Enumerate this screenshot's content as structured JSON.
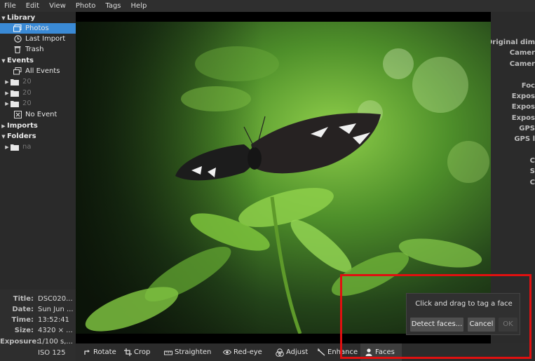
{
  "menu": [
    "File",
    "Edit",
    "View",
    "Photo",
    "Tags",
    "Help"
  ],
  "sidebar": {
    "library_header": "Library",
    "library_items": [
      "Photos",
      "Last Import",
      "Trash"
    ],
    "events_header": "Events",
    "events_items": [
      "All Events",
      "20",
      "20",
      "20",
      "No Event"
    ],
    "imports_header": "Imports",
    "folders_header": "Folders",
    "folders_items": [
      "na"
    ]
  },
  "metadata": [
    {
      "key": "Title:",
      "value": "DSC020..."
    },
    {
      "key": "Date:",
      "value": "Sun Jun ..."
    },
    {
      "key": "Time:",
      "value": "13:52:41"
    },
    {
      "key": "Size:",
      "value": "4320 × ..."
    },
    {
      "key": "Exposure:",
      "value": "1/100 s,..."
    },
    {
      "key": "",
      "value": "ISO 125"
    }
  ],
  "right_panel": [
    "Original dim",
    "Camer",
    "Camer",
    "Foc",
    "Expos",
    "Expos",
    "Expos",
    "GPS",
    "GPS l",
    "C",
    "S",
    "C"
  ],
  "toolbar": [
    {
      "label": "Rotate",
      "icon": "rotate-icon"
    },
    {
      "label": "Crop",
      "icon": "crop-icon"
    },
    {
      "label": "Straighten",
      "icon": "straighten-icon"
    },
    {
      "label": "Red-eye",
      "icon": "eye-icon"
    },
    {
      "label": "Adjust",
      "icon": "adjust-icon"
    },
    {
      "label": "Enhance",
      "icon": "wand-icon"
    },
    {
      "label": "Faces",
      "icon": "person-icon"
    }
  ],
  "faces_popup": {
    "title": "Click and drag to tag a face",
    "detect_label": "Detect faces...",
    "cancel_label": "Cancel",
    "ok_label": "OK"
  },
  "colors": {
    "selection": "#3a8ad6",
    "highlight": "#e01010",
    "background": "#2b2b2b"
  }
}
